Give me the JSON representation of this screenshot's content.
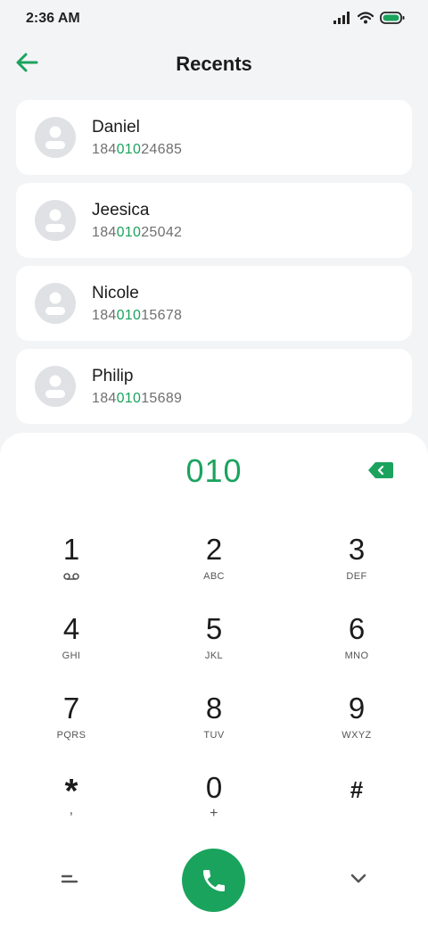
{
  "status_bar": {
    "time": "2:36 AM"
  },
  "header": {
    "title": "Recents"
  },
  "contacts": [
    {
      "name": "Daniel",
      "number_prefix": "184",
      "number_match": "010",
      "number_suffix": "24685"
    },
    {
      "name": "Jeesica",
      "number_prefix": "184",
      "number_match": "010",
      "number_suffix": "25042"
    },
    {
      "name": "Nicole",
      "number_prefix": "184",
      "number_match": "010",
      "number_suffix": "15678"
    },
    {
      "name": "Philip",
      "number_prefix": "184",
      "number_match": "010",
      "number_suffix": "15689"
    }
  ],
  "dialpad": {
    "display": "010",
    "keys": [
      {
        "digit": "1",
        "letters": ""
      },
      {
        "digit": "2",
        "letters": "ABC"
      },
      {
        "digit": "3",
        "letters": "DEF"
      },
      {
        "digit": "4",
        "letters": "GHI"
      },
      {
        "digit": "5",
        "letters": "JKL"
      },
      {
        "digit": "6",
        "letters": "MNO"
      },
      {
        "digit": "7",
        "letters": "PQRS"
      },
      {
        "digit": "8",
        "letters": "TUV"
      },
      {
        "digit": "9",
        "letters": "WXYZ"
      },
      {
        "digit": "*",
        "letters": ","
      },
      {
        "digit": "0",
        "letters": "+"
      },
      {
        "digit": "#",
        "letters": ""
      }
    ]
  },
  "colors": {
    "accent": "#1ba35e",
    "call_button": "#1aa35c",
    "background": "#f3f4f6",
    "card": "#ffffff",
    "avatar": "#dfe1e5"
  },
  "icons": {
    "back": "arrow-left-icon",
    "backspace": "backspace-icon",
    "voicemail": "voicemail-icon",
    "call": "phone-icon",
    "menu": "menu-lines-icon",
    "collapse": "chevron-down-icon"
  }
}
